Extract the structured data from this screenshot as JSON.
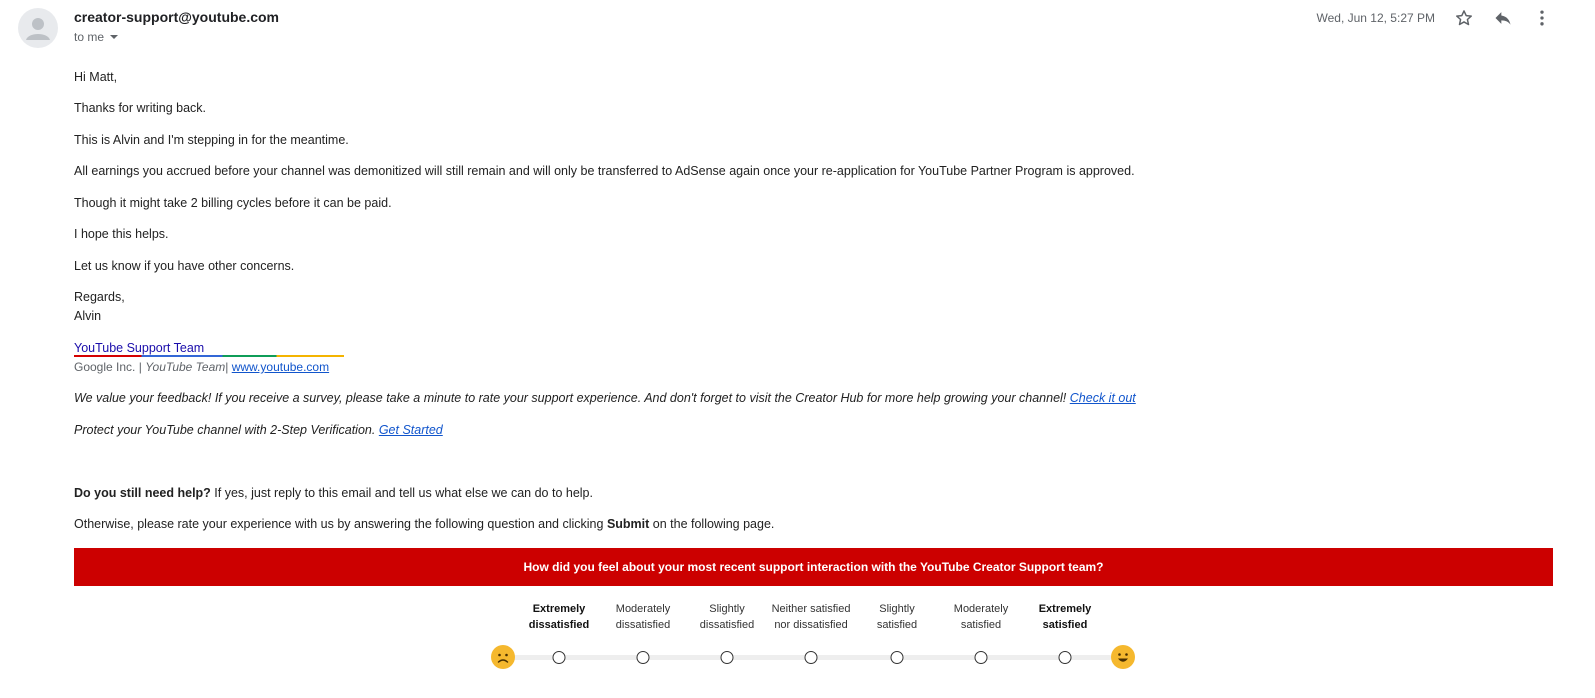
{
  "header": {
    "sender": "creator-support@youtube.com",
    "recipient_label": "to me",
    "date": "Wed, Jun 12, 5:27 PM"
  },
  "body": {
    "greeting": "Hi Matt,",
    "p1": "Thanks for writing back.",
    "p2": "This is Alvin and I'm stepping in for the meantime.",
    "p3": "All earnings you accrued before your channel was demonitized will still remain and will only be transferred to AdSense again once your re-application for YouTube Partner Program is approved.",
    "p4": "Though it might take 2 billing cycles before it can be paid.",
    "p5": "I hope this helps.",
    "p6": "Let us know if you have other concerns.",
    "regards": "Regards,",
    "name": "Alvin"
  },
  "signature": {
    "team": "YouTube Support Team",
    "company": "Google Inc.",
    "separator": "|",
    "team_italic": "YouTube Team",
    "website": "www.youtube.com"
  },
  "footer": {
    "feedback": "We value your feedback! If you receive a survey, please take a minute to rate your support experience. And don't forget to visit the Creator Hub for more help growing your channel!",
    "check_link": "Check it out",
    "protect": "Protect your YouTube channel with 2-Step Verification.",
    "get_started": "Get Started",
    "still_help_bold": "Do you still need help?",
    "still_help_rest": " If yes, just reply to this email and tell us what else we can do to help.",
    "otherwise_pre": "Otherwise, please rate your experience with us by answering the following question and clicking ",
    "submit": "Submit",
    "otherwise_post": " on the following page."
  },
  "survey": {
    "question": "How did you feel about your most recent support interaction with the YouTube Creator Support team?",
    "options": [
      {
        "l1": "Extremely",
        "l2": "dissatisfied"
      },
      {
        "l1": "Moderately",
        "l2": "dissatisfied"
      },
      {
        "l1": "Slightly",
        "l2": "dissatisfied"
      },
      {
        "l1": "Neither satisfied",
        "l2": "nor dissatisfied"
      },
      {
        "l1": "Slightly",
        "l2": "satisfied"
      },
      {
        "l1": "Moderately",
        "l2": "satisfied"
      },
      {
        "l1": "Extremely",
        "l2": "satisfied"
      }
    ]
  },
  "colors": {
    "banner": "#cc0000",
    "link": "#1155cc",
    "emoji": "#f5b82e"
  },
  "icons": [
    "avatar-icon",
    "star-icon",
    "reply-icon",
    "more-vert-icon",
    "caret-down-icon",
    "sad-face-icon",
    "happy-face-icon"
  ]
}
